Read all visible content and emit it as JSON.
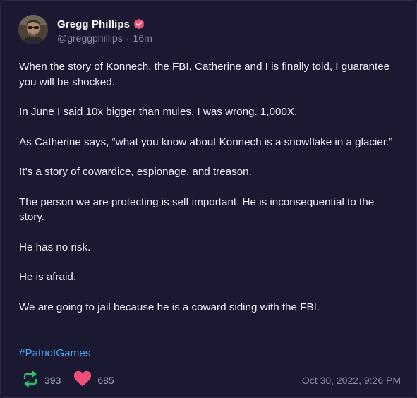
{
  "author": {
    "name": "Gregg Phillips",
    "handle": "@greggphillips",
    "separator": "·",
    "time_ago": "16m",
    "verified_color": "#f24e7a"
  },
  "post": {
    "paragraphs": [
      "When the story of Konnech, the FBI, Catherine and I is finally told, I guarantee you will be shocked.",
      "In June I said 10x bigger than mules, I was wrong. 1,000X.",
      "As Catherine says, “what you know about Konnech is a snowflake in a glacier.”",
      "It’s a story of cowardice, espionage, and treason.",
      "The person we are protecting is self important. He is inconsequential to the story.",
      "He has no risk.",
      "He is afraid.",
      "We are going to jail because he is a coward siding with the FBI."
    ],
    "hashtag": "#PatriotGames"
  },
  "stats": {
    "reposts": "393",
    "likes": "685",
    "repost_icon": "repost-icon",
    "like_icon": "heart-icon",
    "repost_color": "#2fbf6b",
    "like_color": "#f24e7a"
  },
  "timestamp": "Oct 30, 2022, 9:26 PM",
  "colors": {
    "background": "#1b1832",
    "text": "#eeedf5",
    "muted": "#8d89a6",
    "link": "#4aa6f0"
  }
}
